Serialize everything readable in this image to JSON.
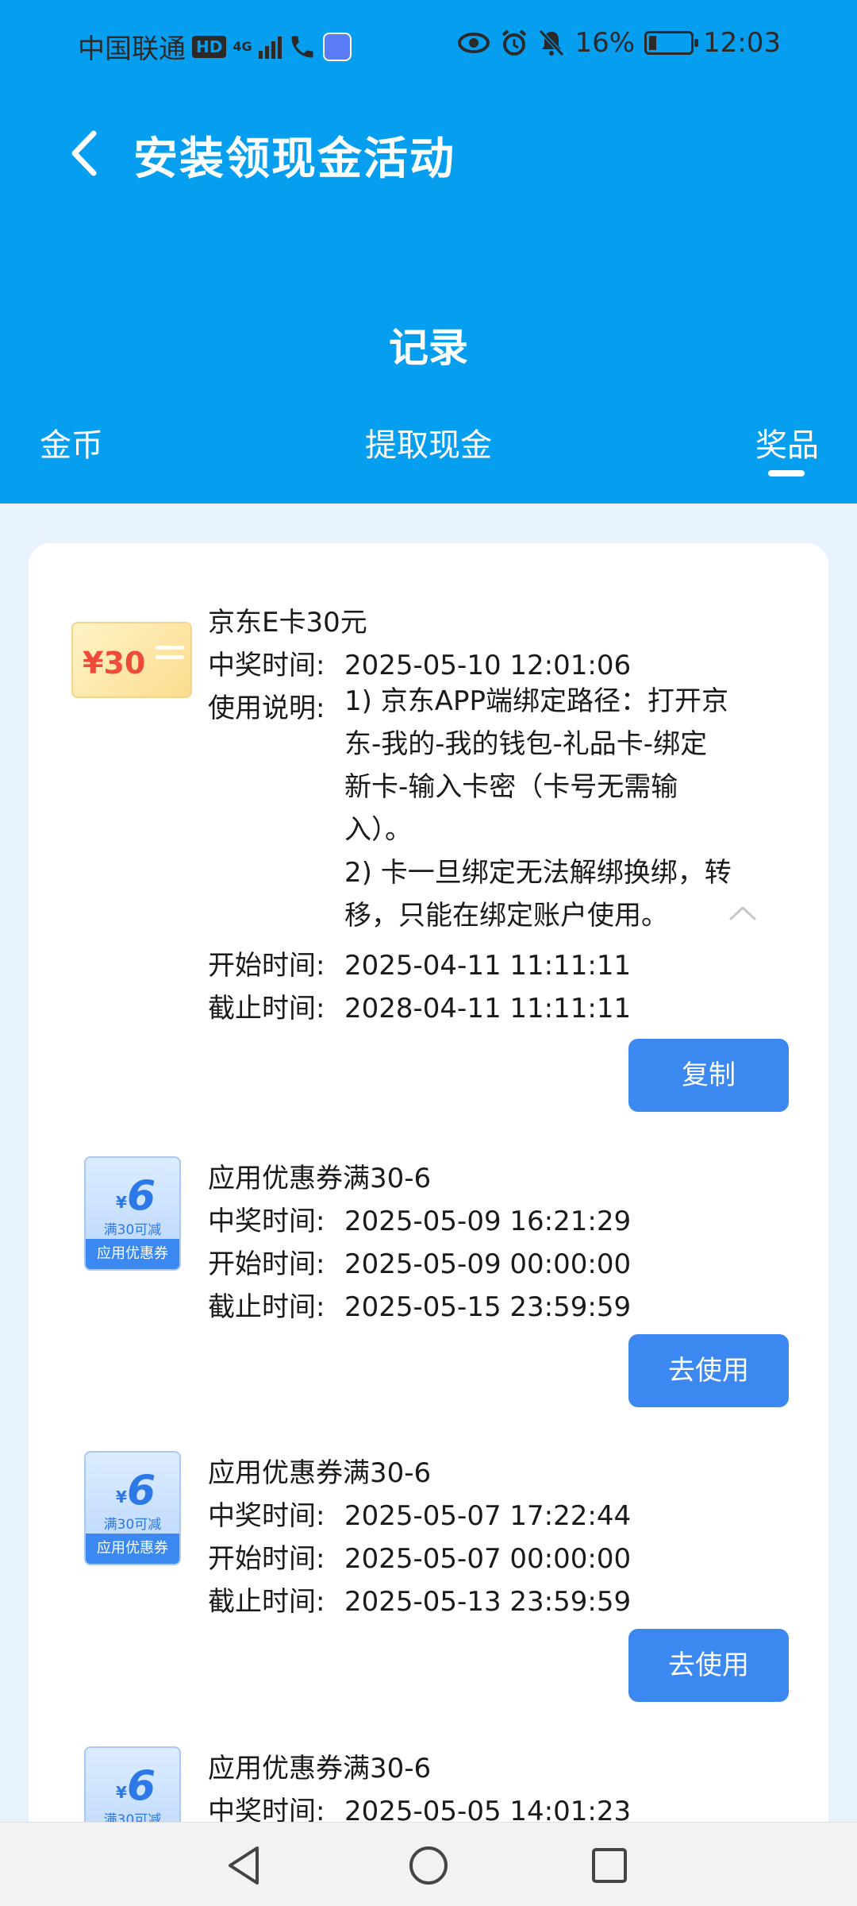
{
  "status_bar": {
    "carrier": "中国联通",
    "hd": "HD",
    "net": "4G",
    "battery": "16%",
    "time": "12:03"
  },
  "header": {
    "title": "安装领现金活动",
    "section": "记录",
    "tabs": [
      "金币",
      "提取现金",
      "奖品"
    ],
    "active_tab": "奖品"
  },
  "prizes": [
    {
      "name": "京东E卡30元",
      "thumb_text": "¥30",
      "win_label": "中奖时间:",
      "win_time": "2025-05-10 12:01:06",
      "desc_label": "使用说明:",
      "desc_lines": [
        "1) 京东APP端绑定路径：打开京",
        "东-我的-我的钱包-礼品卡-绑定",
        "新卡-输入卡密（卡号无需输",
        "入）。",
        "2) 卡一旦绑定无法解绑换绑，转",
        "移，只能在绑定账户使用。"
      ],
      "start_label": "开始时间:",
      "start_time": "2025-04-11 11:11:11",
      "end_label": "截止时间:",
      "end_time": "2028-04-11 11:11:11",
      "button": "复制"
    },
    {
      "name": "应用优惠券满30-6",
      "win_label": "中奖时间:",
      "win_time": "2025-05-09 16:21:29",
      "start_label": "开始时间:",
      "start_time": "2025-05-09 00:00:00",
      "end_label": "截止时间:",
      "end_time": "2025-05-15 23:59:59",
      "button": "去使用"
    },
    {
      "name": "应用优惠券满30-6",
      "win_label": "中奖时间:",
      "win_time": "2025-05-07 17:22:44",
      "start_label": "开始时间:",
      "start_time": "2025-05-07 00:00:00",
      "end_label": "截止时间:",
      "end_time": "2025-05-13 23:59:59",
      "button": "去使用"
    },
    {
      "name": "应用优惠券满30-6",
      "win_label": "中奖时间:",
      "win_time": "2025-05-05 14:01:23"
    }
  ],
  "coupon_thumb": {
    "yen": "¥",
    "amount": "6",
    "condition": "满30可减",
    "caption": "应用优惠券"
  },
  "colors": {
    "header_bg": "#069ff0",
    "button_bg": "#3a88f0",
    "page_bg": "#e9f3fd"
  }
}
